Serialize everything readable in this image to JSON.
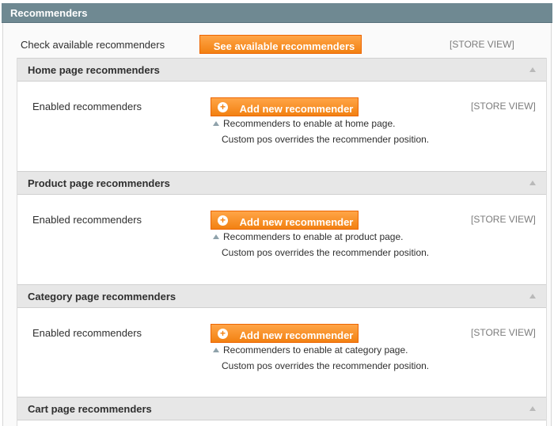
{
  "header": {
    "title": "Recommenders"
  },
  "top": {
    "label": "Check available recommenders",
    "button_label": "See available recommenders",
    "scope": "[STORE VIEW]"
  },
  "sections": [
    {
      "title": "Home page recommenders",
      "field_label": "Enabled recommenders",
      "button_label": "Add new recommender",
      "scope": "[STORE VIEW]",
      "note_line1": "Recommenders to enable at home page.",
      "note_line2": "Custom pos overrides the recommender position."
    },
    {
      "title": "Product page recommenders",
      "field_label": "Enabled recommenders",
      "button_label": "Add new recommender",
      "scope": "[STORE VIEW]",
      "note_line1": "Recommenders to enable at product page.",
      "note_line2": "Custom pos overrides the recommender position."
    },
    {
      "title": "Category page recommenders",
      "field_label": "Enabled recommenders",
      "button_label": "Add new recommender",
      "scope": "[STORE VIEW]",
      "note_line1": "Recommenders to enable at category page.",
      "note_line2": "Custom pos overrides the recommender position."
    },
    {
      "title": "Cart page recommenders"
    }
  ],
  "colors": {
    "header_bg": "#6f8992",
    "button_orange": "#f28112",
    "section_head_bg": "#e7e7e7",
    "store_view_text": "#7c7c7c"
  },
  "icons": {
    "collapse": "chevron-up-icon",
    "add": "plus-circle-icon",
    "note": "note-arrow-icon"
  }
}
